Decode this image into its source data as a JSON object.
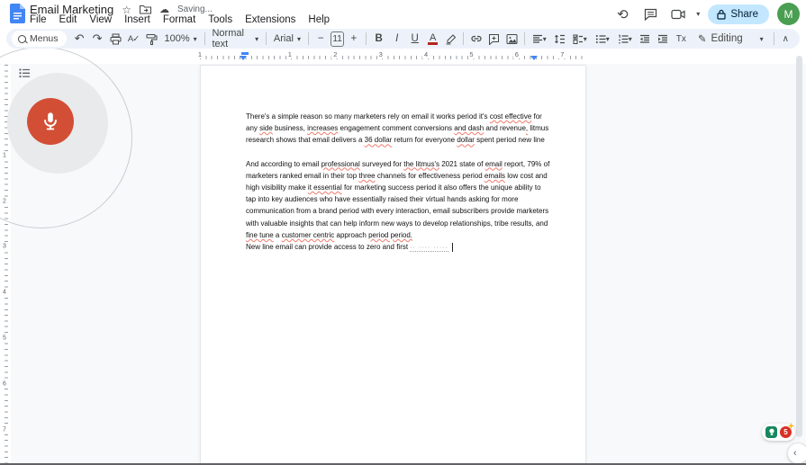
{
  "header": {
    "title": "Email Marketing",
    "saving_status": "Saving...",
    "menu_items": [
      "File",
      "Edit",
      "View",
      "Insert",
      "Format",
      "Tools",
      "Extensions",
      "Help"
    ],
    "share_label": "Share",
    "avatar_initial": "M"
  },
  "toolbar": {
    "menus_label": "Menus",
    "zoom_value": "100%",
    "style_value": "Normal text",
    "font_value": "Arial",
    "font_size_value": "11",
    "mode_label": "Editing"
  },
  "icons": {
    "star": "☆",
    "cloud_sync": "☁",
    "undo": "↶",
    "redo": "↷",
    "caret_down": "▾",
    "minus": "−",
    "plus": "+",
    "bold": "B",
    "italic": "I",
    "underline": "U",
    "text_color": "A",
    "spellcheck": "A✓",
    "clear_format": "Tx",
    "editing_pencil": "✎",
    "collapse_up": "∧",
    "history": "⟲",
    "corner_chevron": "‹"
  },
  "ruler": {
    "margin_number": "1",
    "numbers": [
      "1",
      "2",
      "3",
      "4",
      "5",
      "6",
      "7"
    ],
    "v_numbers": [
      "1",
      "2",
      "3",
      "4",
      "5",
      "6",
      "7"
    ]
  },
  "document": {
    "paragraphs": [
      {
        "lines": [
          [
            {
              "t": "There's a simple reason so many marketers rely on email it works period it's "
            },
            {
              "t": "cost effective",
              "u": true
            },
            {
              "t": " for"
            }
          ],
          [
            {
              "t": "any "
            },
            {
              "t": "side",
              "u": true
            },
            {
              "t": " business, "
            },
            {
              "t": "increases",
              "u": true
            },
            {
              "t": " engagement comment conversions "
            },
            {
              "t": "and dash",
              "u": true
            },
            {
              "t": " and revenue"
            },
            {
              "t": ",",
              "u": true
            },
            {
              "t": " litmus"
            }
          ],
          [
            {
              "t": "research shows that email delivers a "
            },
            {
              "t": "36 dollar",
              "u": true
            },
            {
              "t": " return for everyone "
            },
            {
              "t": "dollar",
              "u": true
            },
            {
              "t": " spent period new line"
            }
          ]
        ]
      },
      {
        "lines": [
          [
            {
              "t": "And according to email "
            },
            {
              "t": "professional",
              "u": true
            },
            {
              "t": " surveyed for "
            },
            {
              "t": "the litmus's",
              "u": true
            },
            {
              "t": " 2021 state of "
            },
            {
              "t": "email",
              "u": true
            },
            {
              "t": " report, 79% of"
            }
          ],
          [
            {
              "t": "marketers ranked email in their top "
            },
            {
              "t": "three",
              "u": true
            },
            {
              "t": " channels for effectiveness period "
            },
            {
              "t": "emails",
              "u": true
            },
            {
              "t": " low cost and"
            }
          ],
          [
            {
              "t": "high visibility make "
            },
            {
              "t": "it essential",
              "u": true
            },
            {
              "t": " for marketing success period it also offers the unique ability to"
            }
          ],
          [
            {
              "t": "tap into key audiences who have essentially raised their virtual hands asking for more"
            }
          ],
          [
            {
              "t": "communication from a brand period with every interaction, email subscribers provide marketers"
            }
          ],
          [
            {
              "t": "with valuable insights that can help inform new ways to develop relationships, tribe results, and"
            }
          ],
          [
            {
              "t": "fine tune",
              "u": true
            },
            {
              "t": " a "
            },
            {
              "t": "customer centric",
              "u": true
            },
            {
              "t": " approach "
            },
            {
              "t": "period period.",
              "u": true
            }
          ],
          [
            {
              "t": "New line email can provide access to zero and first "
            },
            {
              "t": "·· ···· ·····",
              "i": true
            },
            {
              "t": "",
              "c": true
            }
          ]
        ]
      }
    ]
  },
  "suggestions": {
    "count": "5"
  },
  "colors": {
    "toolbar_bg": "#edf2fa",
    "share_bg": "#c2e7ff",
    "accent_blue": "#4285f4",
    "mic_red": "#d24f35",
    "avatar_green": "#4a9e51",
    "spellcheck_red": "#ef7a6d",
    "suggestion_green": "#17885c",
    "suggestion_red": "#d93025",
    "sparkle_yellow": "#fbbc04"
  }
}
